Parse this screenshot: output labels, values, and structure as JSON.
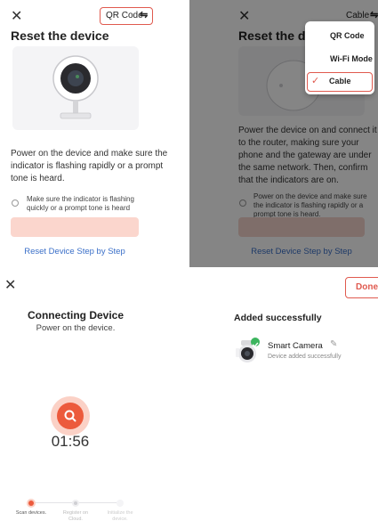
{
  "panel1": {
    "close_icon": "close-icon",
    "mode_label": "QR Code",
    "mode_icon": "swap-icon",
    "title": "Reset the device",
    "instruction": "Power on the device and make sure the indicator is flashing rapidly or a prompt tone is heard.",
    "confirm_text": "Make sure the indicator is flashing quickly or a prompt tone is heard",
    "next_button_label": "",
    "reset_link": "Reset Device Step by Step",
    "accent_color": "#e05a4f"
  },
  "panel2": {
    "close_icon": "close-icon",
    "mode_label": "Cable",
    "mode_icon": "swap-icon",
    "title": "Reset the device",
    "instruction": "Power the device on and connect it to the router, making sure your phone and the gateway are under the same network. Then, confirm that the indicators are on.",
    "confirm_text": "Power on the device and make sure the indicator is flashing rapidly or a prompt tone is heard.",
    "reset_link": "Reset Device Step by Step",
    "menu": {
      "items": [
        "QR Code",
        "Wi-Fi Mode",
        "Cable"
      ],
      "selected": "Cable"
    }
  },
  "panel3": {
    "close_icon": "close-icon",
    "title": "Connecting Device",
    "subtitle": "Power on the device.",
    "timer": "01:56",
    "search_icon": "search-icon",
    "steps": [
      "Scan devices.",
      "Register on Cloud.",
      "Initialize the device."
    ],
    "active_step": 0
  },
  "panel4": {
    "done_label": "Done",
    "heading": "Added successfully",
    "device_name": "Smart Camera",
    "device_status": "Device added successfully",
    "edit_icon": "pencil-icon",
    "check_icon": "check-icon"
  }
}
